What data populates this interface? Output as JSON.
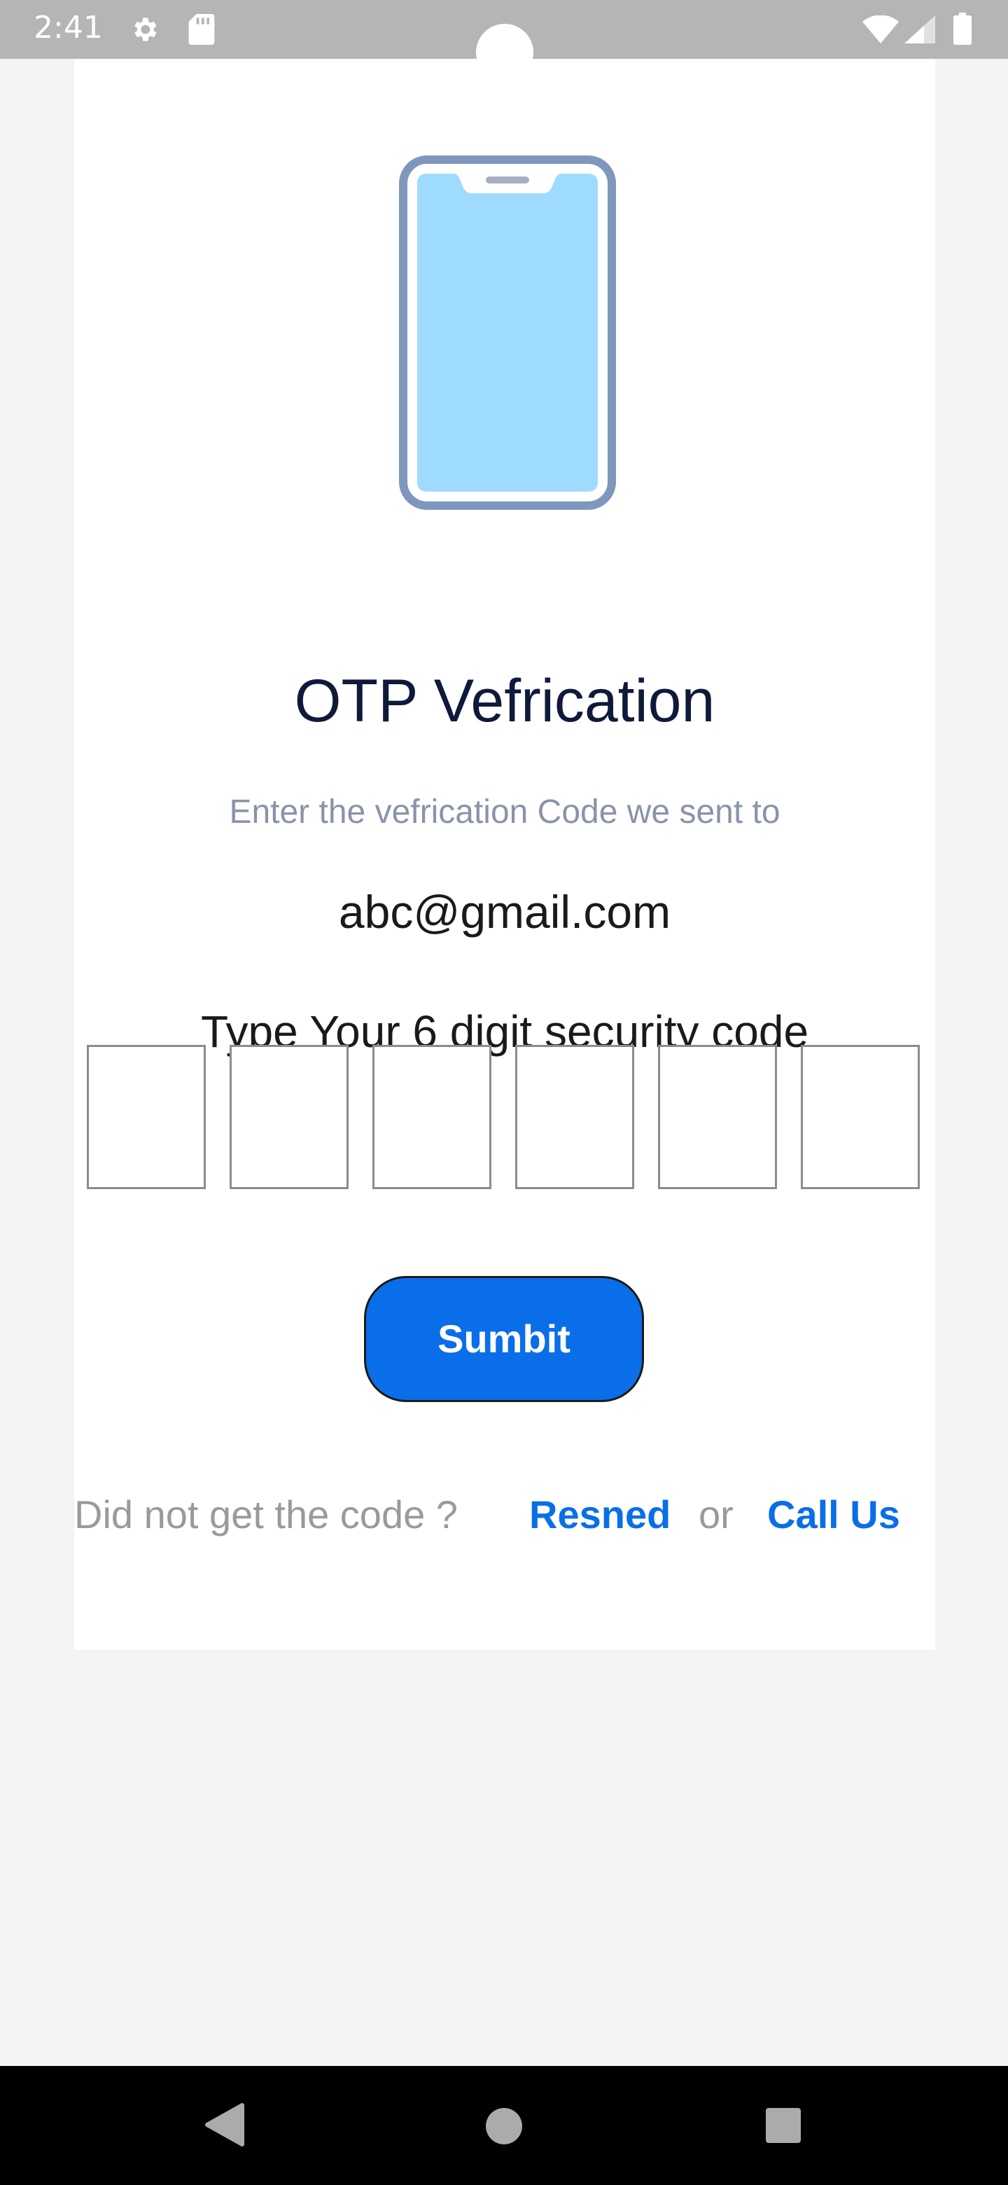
{
  "status_bar": {
    "time": "2:41",
    "icons": [
      "gear-icon",
      "sd-card-icon",
      "wifi-icon",
      "signal-icon",
      "battery-icon"
    ]
  },
  "illustration": {
    "icon": "phone-illustration-icon",
    "screen_color": "#9fdbff",
    "frame_color": "#7f97bd"
  },
  "otp": {
    "title": "OTP Vefrication",
    "subtitle": "Enter the vefrication Code we sent to",
    "email": "abc@gmail.com",
    "code_label": "Type Your 6 digit security code",
    "digits": [
      "",
      "",
      "",
      "",
      "",
      ""
    ],
    "submit_label": "Sumbit",
    "footer": {
      "prompt": "Did not get the code ?",
      "resend": "Resned",
      "or": "or",
      "call_us": "Call Us"
    }
  },
  "colors": {
    "accent": "#0a6ee8",
    "title": "#0f1a3a",
    "muted": "#8a93ab"
  },
  "nav_bar": {
    "icons": [
      "back-icon",
      "home-icon",
      "recents-icon"
    ]
  }
}
